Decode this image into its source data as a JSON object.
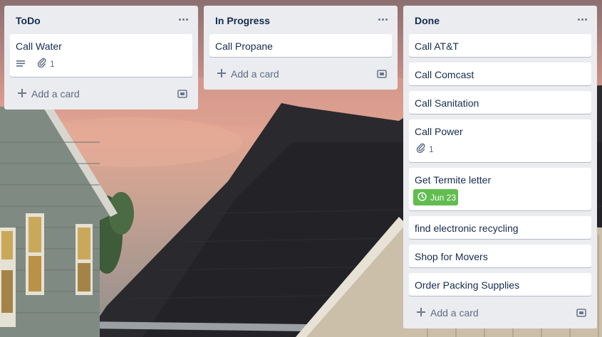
{
  "lists": [
    {
      "title": "ToDo",
      "cards": [
        {
          "title": "Call Water",
          "has_description": true,
          "attachments": "1"
        }
      ],
      "add_card_label": "Add a card"
    },
    {
      "title": "In Progress",
      "cards": [
        {
          "title": "Call Propane"
        }
      ],
      "add_card_label": "Add a card"
    },
    {
      "title": "Done",
      "cards": [
        {
          "title": "Call AT&T"
        },
        {
          "title": "Call Comcast"
        },
        {
          "title": "Call Sanitation"
        },
        {
          "title": "Call Power",
          "attachments": "1"
        },
        {
          "title": "Get Termite letter",
          "due": "Jun 23",
          "due_status": "complete"
        },
        {
          "title": "find electronic recycling"
        },
        {
          "title": "Shop for Movers"
        },
        {
          "title": "Order Packing Supplies"
        }
      ],
      "add_card_label": "Add a card"
    }
  ],
  "icons": {
    "list_menu": "ellipsis-icon",
    "description": "description-icon",
    "attachment": "paperclip-icon",
    "due": "clock-icon",
    "add": "plus-icon",
    "template": "card-template-icon"
  },
  "colors": {
    "list_bg": "#ebecf0",
    "card_bg": "#ffffff",
    "due_complete": "#61bd4f",
    "text": "#172b4d",
    "muted": "#5e6c84"
  }
}
